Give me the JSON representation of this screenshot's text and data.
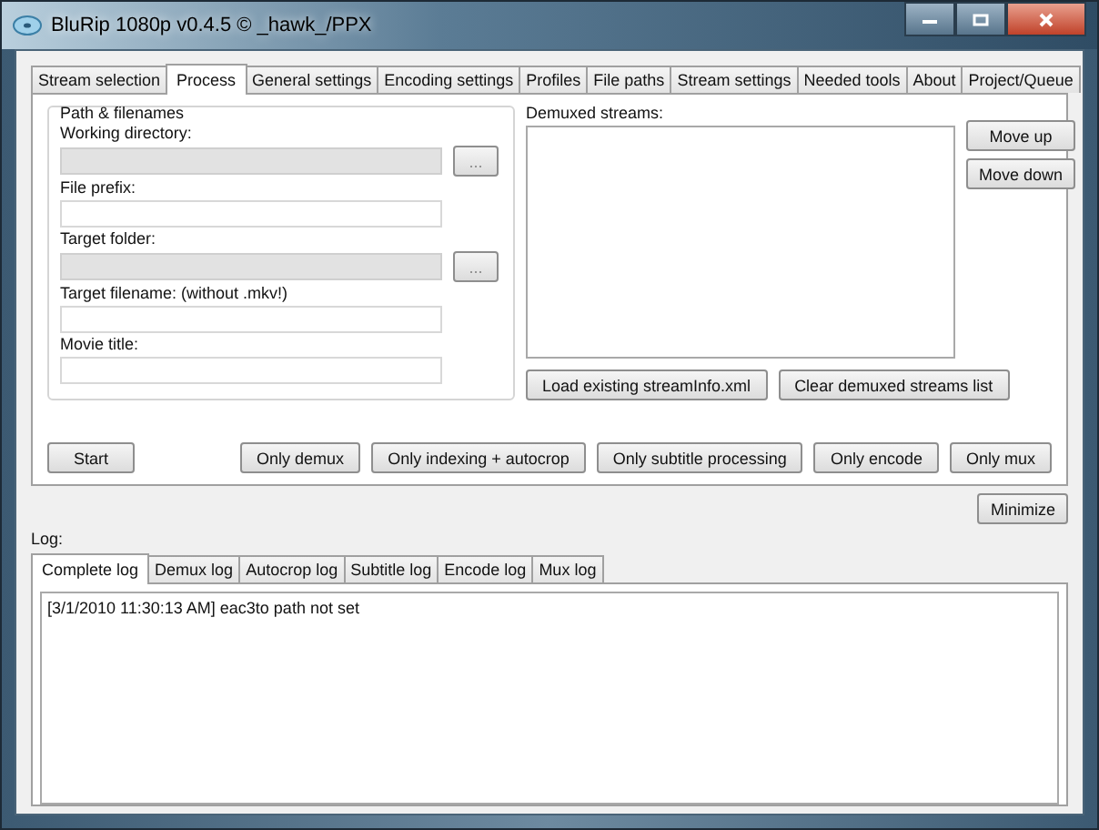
{
  "window": {
    "title": "BluRip 1080p v0.4.5 © _hawk_/PPX"
  },
  "tabs": [
    {
      "label": "Stream selection",
      "selected": false
    },
    {
      "label": "Process",
      "selected": true
    },
    {
      "label": "General settings",
      "selected": false
    },
    {
      "label": "Encoding settings",
      "selected": false
    },
    {
      "label": "Profiles",
      "selected": false
    },
    {
      "label": "File paths",
      "selected": false
    },
    {
      "label": "Stream settings",
      "selected": false
    },
    {
      "label": "Needed tools",
      "selected": false
    },
    {
      "label": "About",
      "selected": false
    },
    {
      "label": "Project/Queue",
      "selected": false
    }
  ],
  "path_group": {
    "title": "Path & filenames",
    "fields": [
      {
        "label": "Working directory:",
        "disabled": true,
        "browse": "..."
      },
      {
        "label": "File prefix:",
        "disabled": false
      },
      {
        "label": "Target folder:",
        "disabled": true,
        "browse": "..."
      },
      {
        "label": "Target filename: (without .mkv!)",
        "disabled": false
      },
      {
        "label": "Movie title:",
        "disabled": false
      }
    ]
  },
  "demuxed": {
    "label": "Demuxed streams:",
    "buttons": [
      "Load existing streamInfo.xml",
      "Clear demuxed streams list"
    ],
    "side_buttons": [
      "Move up",
      "Move down"
    ]
  },
  "start_button": "Start",
  "action_buttons": [
    "Only demux",
    "Only indexing + autocrop",
    "Only subtitle processing",
    "Only encode",
    "Only mux"
  ],
  "minimize_button": "Minimize",
  "log": {
    "label": "Log:",
    "tabs": [
      {
        "label": "Complete log",
        "selected": true
      },
      {
        "label": "Demux log",
        "selected": false
      },
      {
        "label": "Autocrop log",
        "selected": false
      },
      {
        "label": "Subtitle log",
        "selected": false
      },
      {
        "label": "Encode log",
        "selected": false
      },
      {
        "label": "Mux log",
        "selected": false
      }
    ],
    "lines": [
      "[3/1/2010 11:30:13 AM] eac3to path not set"
    ]
  }
}
